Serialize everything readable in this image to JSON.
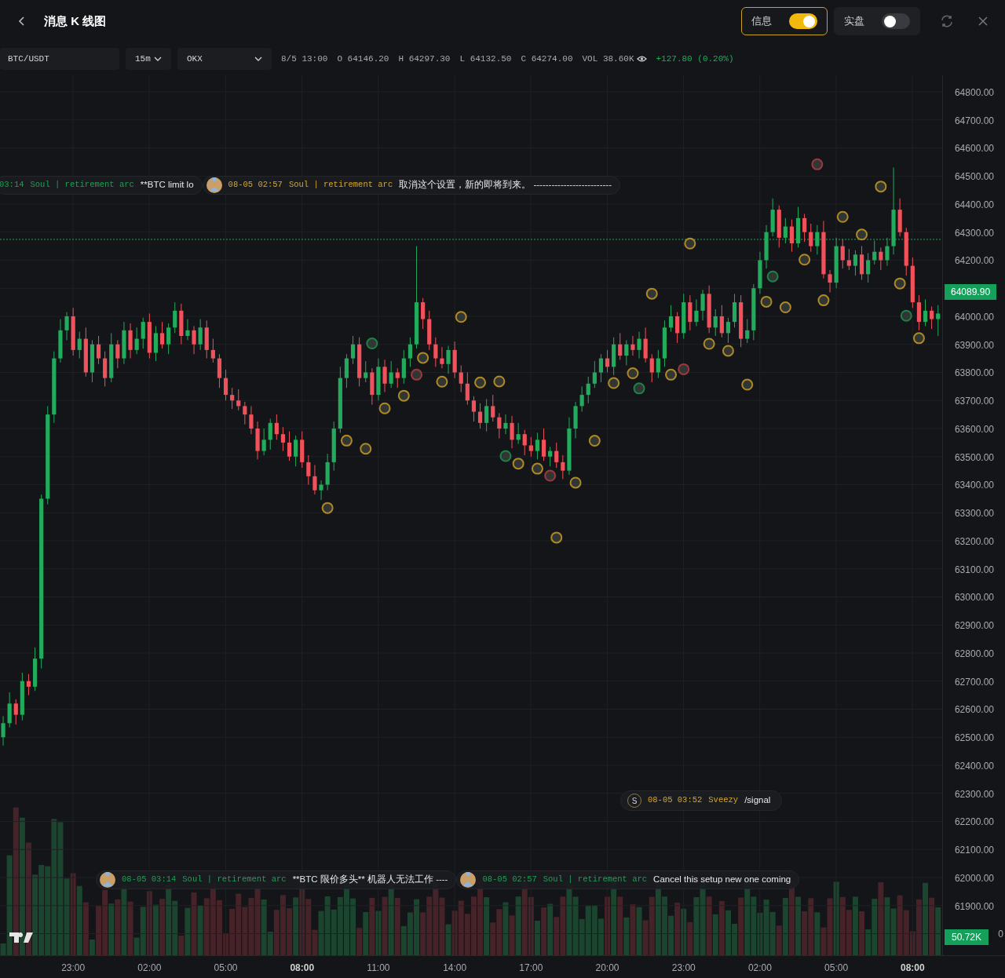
{
  "header": {
    "title": "消息 K 线图",
    "toggles": [
      {
        "label": "信息",
        "on": true
      },
      {
        "label": "实盘",
        "on": false
      }
    ]
  },
  "toolbar": {
    "symbol": "BTC/USDT",
    "interval": "15m",
    "exchange": "OKX",
    "readout": [
      {
        "kind": "plain",
        "text": "8/5 13:00"
      },
      {
        "kind": "plain",
        "text": "O 64146.20"
      },
      {
        "kind": "plain",
        "text": "H 64297.30"
      },
      {
        "kind": "plain",
        "text": "L 64132.50"
      },
      {
        "kind": "plain",
        "text": "C 64274.00"
      },
      {
        "kind": "volume",
        "text": "VOL 38.60K"
      },
      {
        "kind": "change",
        "text": "+127.80 (0.20%)"
      }
    ]
  },
  "chart": {
    "chart_data": {
      "type": "candlestick",
      "ylim": [
        61723,
        64858.7
      ],
      "grid": true,
      "ref_lines": [
        {
          "axis": "y",
          "value": 64274
        }
      ],
      "yticks": [
        {
          "value": 64800,
          "label": "64800.00"
        },
        {
          "value": 64700,
          "label": "64700.00"
        },
        {
          "value": 64600,
          "label": "64600.00"
        },
        {
          "value": 64500,
          "label": "64500.00"
        },
        {
          "value": 64400,
          "label": "64400.00"
        },
        {
          "value": 64300,
          "label": "64300.00"
        },
        {
          "value": 64200,
          "label": "64200.00"
        },
        {
          "value": 64000,
          "label": "64000.00"
        },
        {
          "value": 63900,
          "label": "63900.00"
        },
        {
          "value": 63800,
          "label": "63800.00"
        },
        {
          "value": 63700,
          "label": "63700.00"
        },
        {
          "value": 63600,
          "label": "63600.00"
        },
        {
          "value": 63500,
          "label": "63500.00"
        },
        {
          "value": 63400,
          "label": "63400.00"
        },
        {
          "value": 63300,
          "label": "63300.00"
        },
        {
          "value": 63200,
          "label": "63200.00"
        },
        {
          "value": 63100,
          "label": "63100.00"
        },
        {
          "value": 63000,
          "label": "63000.00"
        },
        {
          "value": 62900,
          "label": "62900.00"
        },
        {
          "value": 62800,
          "label": "62800.00"
        },
        {
          "value": 62700,
          "label": "62700.00"
        },
        {
          "value": 62600,
          "label": "62600.00"
        },
        {
          "value": 62500,
          "label": "62500.00"
        },
        {
          "value": 62400,
          "label": "62400.00"
        },
        {
          "value": 62300,
          "label": "62300.00"
        },
        {
          "value": 62200,
          "label": "62200.00"
        },
        {
          "value": 62100,
          "label": "62100.00"
        },
        {
          "value": 62000,
          "label": "62000.00"
        },
        {
          "value": 61900,
          "label": "61900.00"
        }
      ],
      "categories": [
        null,
        null,
        null,
        null,
        null,
        null,
        null,
        null,
        null,
        null,
        null,
        "23:00",
        null,
        null,
        null,
        null,
        null,
        null,
        null,
        null,
        null,
        null,
        null,
        "02:00",
        null,
        null,
        null,
        null,
        null,
        null,
        null,
        null,
        null,
        null,
        null,
        "05:00",
        null,
        null,
        null,
        null,
        null,
        null,
        null,
        null,
        null,
        null,
        null,
        "08:00",
        null,
        null,
        null,
        null,
        null,
        null,
        null,
        null,
        null,
        null,
        null,
        "11:00",
        null,
        null,
        null,
        null,
        null,
        null,
        null,
        null,
        null,
        null,
        null,
        "14:00",
        null,
        null,
        null,
        null,
        null,
        null,
        null,
        null,
        null,
        null,
        null,
        "17:00",
        null,
        null,
        null,
        null,
        null,
        null,
        null,
        null,
        null,
        null,
        null,
        "20:00",
        null,
        null,
        null,
        null,
        null,
        null,
        null,
        null,
        null,
        null,
        null,
        "23:00",
        null,
        null,
        null,
        null,
        null,
        null,
        null,
        null,
        null,
        null,
        null,
        "02:00",
        null,
        null,
        null,
        null,
        null,
        null,
        null,
        null,
        null,
        null,
        null,
        "05:00",
        null,
        null,
        null,
        null,
        null,
        null,
        null,
        null,
        null,
        null,
        null,
        "08:00",
        null,
        null,
        null,
        null
      ],
      "ohlc": [
        [
          62500,
          62575,
          62470,
          62550
        ],
        [
          62550,
          62660,
          62535,
          62620
        ],
        [
          62620,
          62635,
          62545,
          62580
        ],
        [
          62580,
          62730,
          62560,
          62700
        ],
        [
          62700,
          62725,
          62650,
          62680
        ],
        [
          62680,
          62820,
          62665,
          62780
        ],
        [
          62780,
          63365,
          62745,
          63350
        ],
        [
          63350,
          63680,
          63330,
          63650
        ],
        [
          63650,
          63875,
          63620,
          63850
        ],
        [
          63850,
          63990,
          63835,
          63950
        ],
        [
          63950,
          64015,
          63915,
          64000
        ],
        [
          64000,
          64030,
          63860,
          63880
        ],
        [
          63880,
          63945,
          63850,
          63920
        ],
        [
          63920,
          63960,
          63785,
          63800
        ],
        [
          63800,
          63915,
          63765,
          63900
        ],
        [
          63900,
          63930,
          63830,
          63850
        ],
        [
          63850,
          63875,
          63750,
          63780
        ],
        [
          63780,
          63940,
          63765,
          63900
        ],
        [
          63900,
          63915,
          63815,
          63850
        ],
        [
          63850,
          63980,
          63830,
          63950
        ],
        [
          63950,
          63975,
          63850,
          63880
        ],
        [
          63880,
          63960,
          63865,
          63920
        ],
        [
          63920,
          63995,
          63885,
          63980
        ],
        [
          63980,
          64010,
          63850,
          63870
        ],
        [
          63870,
          63965,
          63840,
          63940
        ],
        [
          63940,
          63980,
          63885,
          63900
        ],
        [
          63900,
          63975,
          63865,
          63960
        ],
        [
          63960,
          64050,
          63940,
          64020
        ],
        [
          64020,
          64045,
          63900,
          63930
        ],
        [
          63930,
          63990,
          63915,
          63950
        ],
        [
          63950,
          63965,
          63865,
          63900
        ],
        [
          63900,
          63990,
          63880,
          63960
        ],
        [
          63960,
          63985,
          63850,
          63880
        ],
        [
          63880,
          63920,
          63835,
          63850
        ],
        [
          63850,
          63865,
          63745,
          63780
        ],
        [
          63780,
          63810,
          63700,
          63720
        ],
        [
          63720,
          63745,
          63670,
          63700
        ],
        [
          63700,
          63740,
          63665,
          63680
        ],
        [
          63680,
          63695,
          63615,
          63650
        ],
        [
          63650,
          63680,
          63580,
          63600
        ],
        [
          63600,
          63625,
          63490,
          63520
        ],
        [
          63520,
          63600,
          63505,
          63560
        ],
        [
          63560,
          63635,
          63525,
          63620
        ],
        [
          63620,
          63650,
          63560,
          63580
        ],
        [
          63580,
          63605,
          63520,
          63550
        ],
        [
          63550,
          63590,
          63485,
          63500
        ],
        [
          63500,
          63575,
          63465,
          63560
        ],
        [
          63560,
          63590,
          63460,
          63480
        ],
        [
          63480,
          63505,
          63400,
          63430
        ],
        [
          63430,
          63470,
          63365,
          63380
        ],
        [
          63380,
          63415,
          63345,
          63400
        ],
        [
          63400,
          63510,
          63380,
          63480
        ],
        [
          63480,
          63625,
          63450,
          63600
        ],
        [
          63600,
          63820,
          63585,
          63780
        ],
        [
          63780,
          63865,
          63745,
          63850
        ],
        [
          63850,
          63930,
          63830,
          63900
        ],
        [
          63900,
          63925,
          63750,
          63780
        ],
        [
          63780,
          63840,
          63765,
          63800
        ],
        [
          63800,
          63815,
          63685,
          63720
        ],
        [
          63720,
          63850,
          63700,
          63820
        ],
        [
          63820,
          63845,
          63730,
          63760
        ],
        [
          63760,
          63840,
          63745,
          63800
        ],
        [
          63800,
          63815,
          63745,
          63780
        ],
        [
          63780,
          63880,
          63760,
          63850
        ],
        [
          63850,
          63925,
          63820,
          63900
        ],
        [
          63900,
          64250,
          63885,
          64050
        ],
        [
          64050,
          64065,
          63955,
          63990
        ],
        [
          63990,
          64020,
          63880,
          63900
        ],
        [
          63900,
          63925,
          63820,
          63850
        ],
        [
          63850,
          63890,
          63815,
          63830
        ],
        [
          63830,
          63895,
          63795,
          63880
        ],
        [
          63880,
          63910,
          63780,
          63800
        ],
        [
          63800,
          63825,
          63730,
          63760
        ],
        [
          63760,
          63800,
          63685,
          63700
        ],
        [
          63700,
          63715,
          63625,
          63660
        ],
        [
          63660,
          63690,
          63600,
          63620
        ],
        [
          63620,
          63705,
          63590,
          63680
        ],
        [
          63680,
          63720,
          63625,
          63640
        ],
        [
          63640,
          63655,
          63565,
          63600
        ],
        [
          63600,
          63650,
          63580,
          63620
        ],
        [
          63620,
          63645,
          63530,
          63560
        ],
        [
          63560,
          63620,
          63545,
          63580
        ],
        [
          63580,
          63595,
          63505,
          63540
        ],
        [
          63540,
          63570,
          63500,
          63520
        ],
        [
          63520,
          63585,
          63490,
          63560
        ],
        [
          63560,
          63600,
          63485,
          63500
        ],
        [
          63500,
          63535,
          63465,
          63520
        ],
        [
          63520,
          63550,
          63460,
          63480
        ],
        [
          63480,
          63505,
          63420,
          63450
        ],
        [
          63450,
          63640,
          63435,
          63600
        ],
        [
          63600,
          63695,
          63565,
          63680
        ],
        [
          63680,
          63750,
          63660,
          63720
        ],
        [
          63720,
          63785,
          63690,
          63760
        ],
        [
          63760,
          63840,
          63745,
          63800
        ],
        [
          63800,
          63865,
          63765,
          63850
        ],
        [
          63850,
          63880,
          63800,
          63820
        ],
        [
          63820,
          63925,
          63790,
          63900
        ],
        [
          63900,
          63940,
          63845,
          63860
        ],
        [
          63860,
          63915,
          63825,
          63900
        ],
        [
          63900,
          63930,
          63860,
          63880
        ],
        [
          63880,
          63945,
          63850,
          63920
        ],
        [
          63920,
          63960,
          63835,
          63850
        ],
        [
          63850,
          63865,
          63765,
          63800
        ],
        [
          63800,
          63880,
          63780,
          63850
        ],
        [
          63850,
          63985,
          63820,
          63960
        ],
        [
          63960,
          64040,
          63945,
          64000
        ],
        [
          64000,
          64015,
          63905,
          63940
        ],
        [
          63940,
          64080,
          63920,
          64050
        ],
        [
          64050,
          64075,
          63950,
          63980
        ],
        [
          63980,
          64060,
          63965,
          64020
        ],
        [
          64020,
          64095,
          63985,
          64080
        ],
        [
          64080,
          64110,
          63940,
          63960
        ],
        [
          63960,
          64025,
          63930,
          64000
        ],
        [
          64000,
          64040,
          63925,
          63940
        ],
        [
          63940,
          63995,
          63905,
          63980
        ],
        [
          63980,
          64080,
          63960,
          64050
        ],
        [
          64050,
          64075,
          63890,
          63920
        ],
        [
          63920,
          63990,
          63905,
          63950
        ],
        [
          63950,
          64115,
          63915,
          64100
        ],
        [
          64100,
          64230,
          64080,
          64200
        ],
        [
          64200,
          64325,
          64170,
          64300
        ],
        [
          64300,
          64420,
          64285,
          64380
        ],
        [
          64380,
          64395,
          64245,
          64280
        ],
        [
          64280,
          64350,
          64260,
          64320
        ],
        [
          64320,
          64345,
          64230,
          64260
        ],
        [
          64260,
          64390,
          64245,
          64350
        ],
        [
          64350,
          64365,
          64265,
          64300
        ],
        [
          64300,
          64330,
          64230,
          64250
        ],
        [
          64250,
          64325,
          64220,
          64300
        ],
        [
          64300,
          64340,
          64135,
          64150
        ],
        [
          64150,
          64165,
          64085,
          64120
        ],
        [
          64120,
          64280,
          64100,
          64250
        ],
        [
          64250,
          64275,
          64170,
          64200
        ],
        [
          64200,
          64240,
          64165,
          64180
        ],
        [
          64180,
          64235,
          64145,
          64220
        ],
        [
          64220,
          64250,
          64130,
          64150
        ],
        [
          64150,
          64225,
          64120,
          64200
        ],
        [
          64200,
          64270,
          64185,
          64230
        ],
        [
          64230,
          64245,
          64165,
          64200
        ],
        [
          64200,
          64280,
          64180,
          64250
        ],
        [
          64250,
          64530,
          64220,
          64380
        ],
        [
          64380,
          64420,
          64285,
          64300
        ],
        [
          64300,
          64315,
          64145,
          64180
        ],
        [
          64180,
          64210,
          64030,
          64050
        ],
        [
          64050,
          64075,
          63950,
          63980
        ],
        [
          63980,
          64060,
          63965,
          64020
        ],
        [
          64020,
          64035,
          63955,
          63990
        ],
        [
          63990,
          64040,
          63930,
          64010
        ]
      ]
    }
  },
  "time_labels_bold": [
    false,
    false,
    false,
    true,
    false,
    false,
    false,
    false,
    false,
    false,
    false,
    true
  ],
  "volume_axis_label": "0",
  "current_price": "64089.90",
  "current_volume": "50.72K",
  "message_strips": [
    {
      "messages": [
        {
          "avatar": false,
          "time": "03:14",
          "author": "Soul | retirement arc",
          "color": "#1f9e55",
          "text": "**BTC limit lo"
        },
        {
          "avatar": true,
          "time": "08-05 02:57",
          "author": "Soul | retirement arc",
          "color": "#d4a62a",
          "text": "取消这个设置，新的即将到来。 --------------------------"
        }
      ]
    },
    {
      "messages": [
        {
          "avatar": true,
          "time": "08-05 03:14",
          "author": "Soul | retirement arc",
          "color": "#1f9e55",
          "text": "**BTC 限价多头** 机器人无法工作 ----"
        },
        {
          "avatar": true,
          "time": "08-05 02:57",
          "author": "Soul | retirement arc",
          "color": "#1f9e55",
          "text": "Cancel this setup new one coming"
        }
      ]
    }
  ],
  "signal": {
    "initial": "S",
    "time": "08-05 03:52",
    "author": "Sveezy",
    "text": "/signal"
  }
}
